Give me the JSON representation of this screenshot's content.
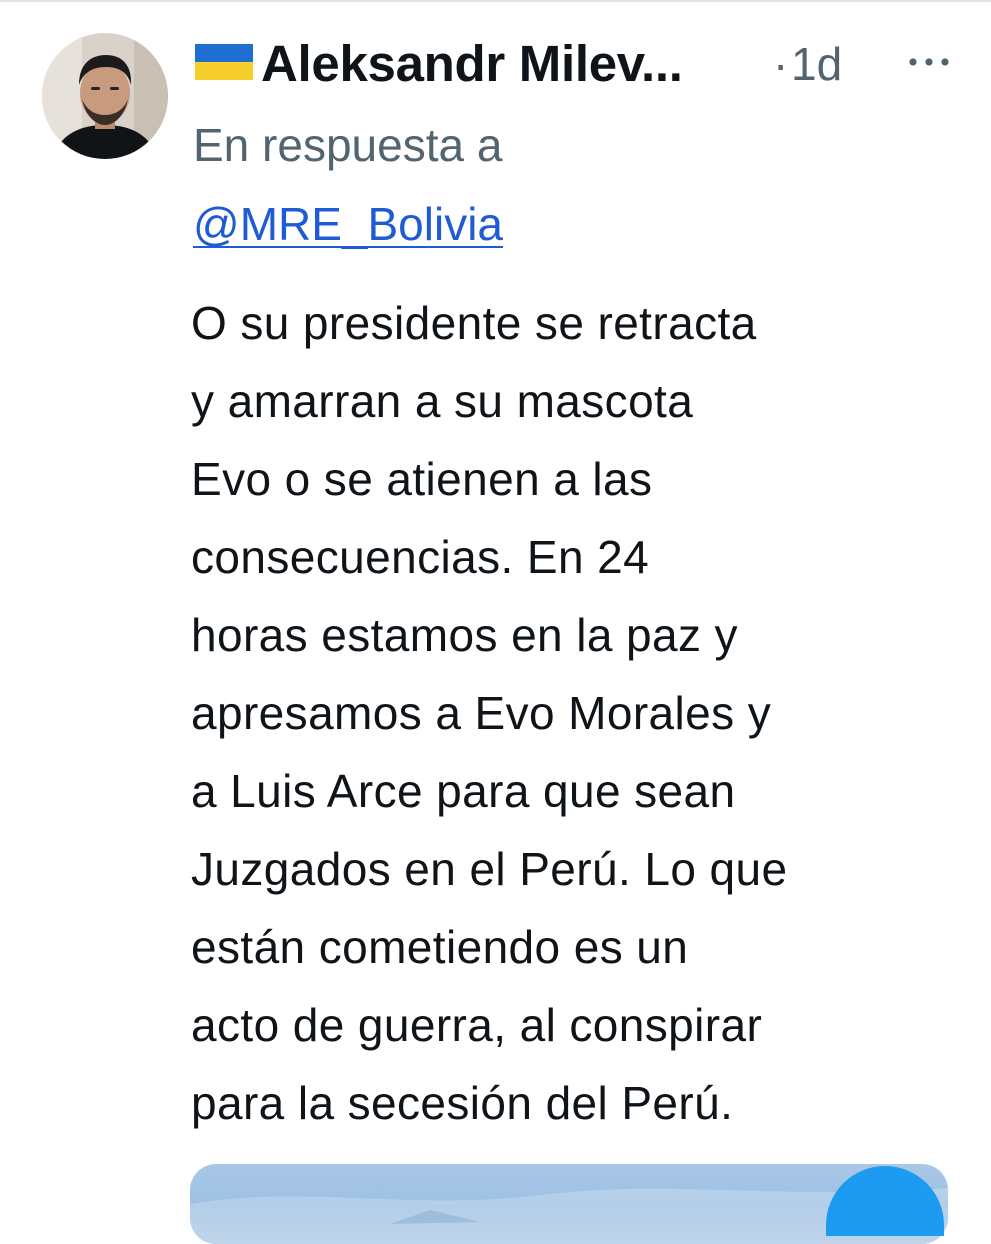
{
  "tweet": {
    "author": {
      "flag_icon": "ukraine-flag-emoji",
      "display_name": "Aleksandr Milev...",
      "avatar_icon": "profile-photo"
    },
    "separator": "·",
    "timestamp": "1d",
    "more_icon": "more-horizontal-icon",
    "reply_to": {
      "prefix": "En respuesta a",
      "handle": "@MRE_Bolivia"
    },
    "text_lines": [
      "O su presidente se retracta",
      "y amarran a su mascota",
      "Evo o se atienen a las",
      "consecuencias. En 24",
      "horas estamos en la paz y",
      "apresamos a Evo Morales y",
      "a Luis Arce para que sean",
      "Juzgados en el Perú. Lo que",
      "están cometiendo es un",
      "acto de guerra, al conspirar",
      "para la secesión del Perú."
    ],
    "media": {
      "icon": "media-image"
    }
  },
  "colors": {
    "text_primary": "#0f1419",
    "text_secondary": "#536471",
    "link": "#1f5bd4",
    "flag_blue": "#1f6fd0",
    "flag_yellow": "#f7cf2c",
    "badge_blue": "#1d9bf0"
  }
}
